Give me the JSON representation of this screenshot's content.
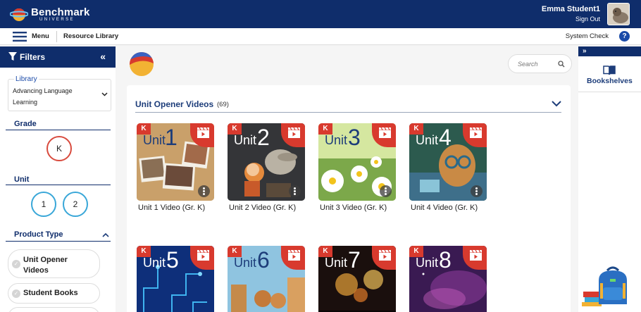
{
  "header": {
    "logo_text": "Benchmark",
    "logo_sub": "UNIVERSE",
    "user_name": "Emma Student1",
    "sign_out": "Sign Out"
  },
  "subbar": {
    "menu_label": "Menu",
    "resource_label": "Resource Library",
    "system_check": "System Check",
    "help": "?"
  },
  "filters": {
    "title": "Filters",
    "collapse": "«",
    "library_label": "Library",
    "library_value": "Advancing Language Learning",
    "grade_label": "Grade",
    "grade_options": [
      "K"
    ],
    "unit_label": "Unit",
    "unit_options": [
      "1",
      "2"
    ],
    "product_type_label": "Product Type",
    "product_types": [
      "Unit Opener Videos",
      "Student Books"
    ]
  },
  "main": {
    "search_placeholder": "Search",
    "section_title": "Unit Opener Videos",
    "section_count": "(69)",
    "items": [
      {
        "unit_word": "Unit",
        "num": "1",
        "grade": "K",
        "label": "Unit 1 Video (Gr. K)"
      },
      {
        "unit_word": "Unit",
        "num": "2",
        "grade": "K",
        "label": "Unit 2 Video (Gr. K)"
      },
      {
        "unit_word": "Unit",
        "num": "3",
        "grade": "K",
        "label": "Unit 3 Video (Gr. K)"
      },
      {
        "unit_word": "Unit",
        "num": "4",
        "grade": "K",
        "label": "Unit 4 Video (Gr. K)"
      },
      {
        "unit_word": "Unit",
        "num": "5",
        "grade": "K"
      },
      {
        "unit_word": "Unit",
        "num": "6",
        "grade": "K"
      },
      {
        "unit_word": "Unit",
        "num": "7",
        "grade": "K"
      },
      {
        "unit_word": "Unit",
        "num": "8",
        "grade": "K"
      }
    ]
  },
  "right_panel": {
    "toggle": "»",
    "bookshelves_label": "Bookshelves"
  },
  "colors": {
    "navy": "#0f2d6b",
    "accent_red": "#d83a2e",
    "unit_blue": "#39a7d8"
  }
}
